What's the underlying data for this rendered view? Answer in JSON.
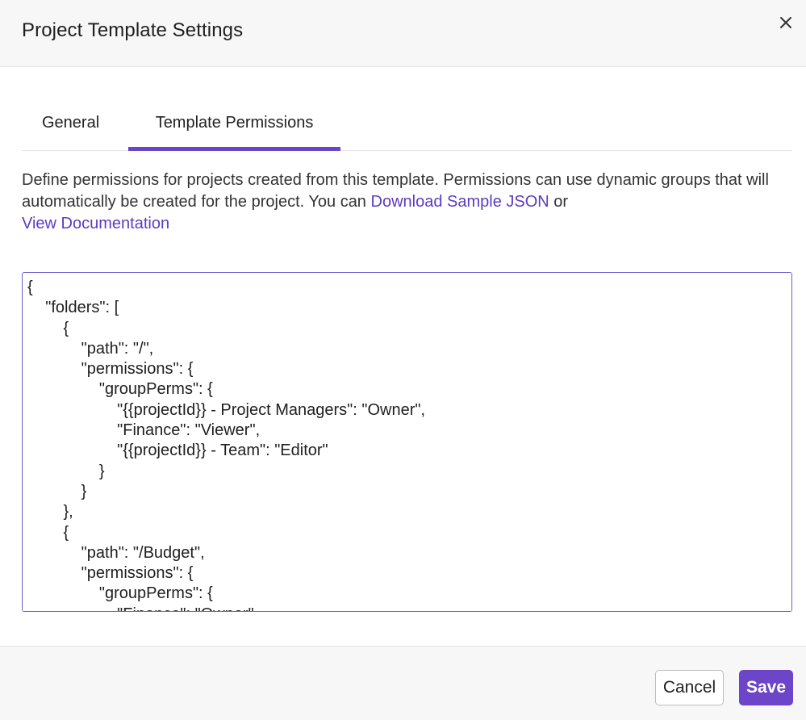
{
  "dialog": {
    "title": "Project Template Settings",
    "close_icon": "close-icon"
  },
  "tabs": [
    {
      "label": "General",
      "active": false
    },
    {
      "label": "Template Permissions",
      "active": true
    }
  ],
  "description": {
    "text_before": "Define permissions for projects created from this template. Permissions can use dynamic groups that will automatically be created for the project. You can ",
    "download_link": "Download Sample JSON",
    "text_between": " or ",
    "docs_link": "View Documentation"
  },
  "editor": {
    "value": "{\n    \"folders\": [\n        {\n            \"path\": \"/\",\n            \"permissions\": {\n                \"groupPerms\": {\n                    \"{{projectId}} - Project Managers\": \"Owner\",\n                    \"Finance\": \"Viewer\",\n                    \"{{projectId}} - Team\": \"Editor\"\n                }\n            }\n        },\n        {\n            \"path\": \"/Budget\",\n            \"permissions\": {\n                \"groupPerms\": {\n                    \"Finance\": \"Owner\",\n                    \"{{projectId}} - Project Managers\": \"Editor\"\n                }\n            }\n        }\n    ]\n}"
  },
  "footer": {
    "cancel_label": "Cancel",
    "save_label": "Save"
  },
  "colors": {
    "accent": "#6c45c8",
    "link": "#5b3cc4"
  }
}
